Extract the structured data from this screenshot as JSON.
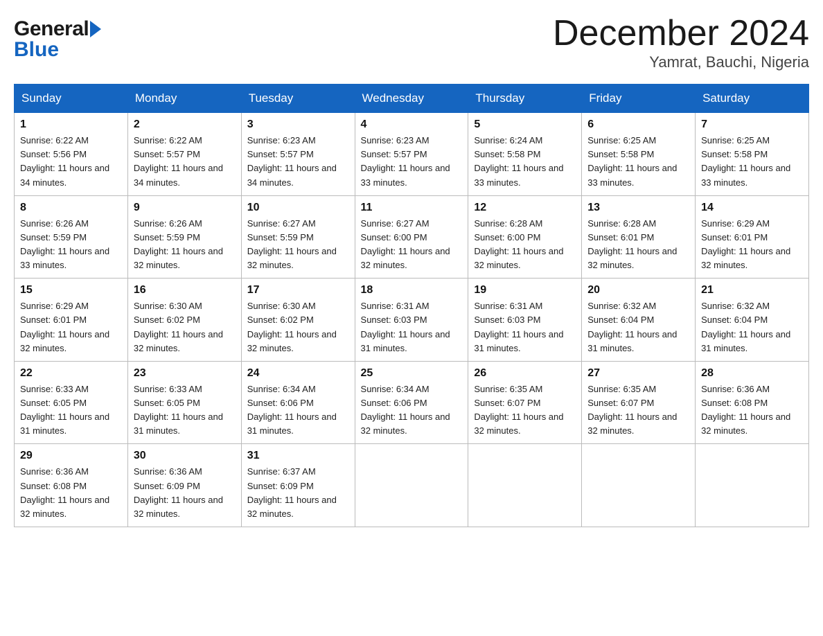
{
  "header": {
    "title": "December 2024",
    "subtitle": "Yamrat, Bauchi, Nigeria"
  },
  "logo": {
    "general": "General",
    "blue": "Blue"
  },
  "days_of_week": [
    "Sunday",
    "Monday",
    "Tuesday",
    "Wednesday",
    "Thursday",
    "Friday",
    "Saturday"
  ],
  "weeks": [
    [
      {
        "day": "1",
        "sunrise": "6:22 AM",
        "sunset": "5:56 PM",
        "daylight": "11 hours and 34 minutes."
      },
      {
        "day": "2",
        "sunrise": "6:22 AM",
        "sunset": "5:57 PM",
        "daylight": "11 hours and 34 minutes."
      },
      {
        "day": "3",
        "sunrise": "6:23 AM",
        "sunset": "5:57 PM",
        "daylight": "11 hours and 34 minutes."
      },
      {
        "day": "4",
        "sunrise": "6:23 AM",
        "sunset": "5:57 PM",
        "daylight": "11 hours and 33 minutes."
      },
      {
        "day": "5",
        "sunrise": "6:24 AM",
        "sunset": "5:58 PM",
        "daylight": "11 hours and 33 minutes."
      },
      {
        "day": "6",
        "sunrise": "6:25 AM",
        "sunset": "5:58 PM",
        "daylight": "11 hours and 33 minutes."
      },
      {
        "day": "7",
        "sunrise": "6:25 AM",
        "sunset": "5:58 PM",
        "daylight": "11 hours and 33 minutes."
      }
    ],
    [
      {
        "day": "8",
        "sunrise": "6:26 AM",
        "sunset": "5:59 PM",
        "daylight": "11 hours and 33 minutes."
      },
      {
        "day": "9",
        "sunrise": "6:26 AM",
        "sunset": "5:59 PM",
        "daylight": "11 hours and 32 minutes."
      },
      {
        "day": "10",
        "sunrise": "6:27 AM",
        "sunset": "5:59 PM",
        "daylight": "11 hours and 32 minutes."
      },
      {
        "day": "11",
        "sunrise": "6:27 AM",
        "sunset": "6:00 PM",
        "daylight": "11 hours and 32 minutes."
      },
      {
        "day": "12",
        "sunrise": "6:28 AM",
        "sunset": "6:00 PM",
        "daylight": "11 hours and 32 minutes."
      },
      {
        "day": "13",
        "sunrise": "6:28 AM",
        "sunset": "6:01 PM",
        "daylight": "11 hours and 32 minutes."
      },
      {
        "day": "14",
        "sunrise": "6:29 AM",
        "sunset": "6:01 PM",
        "daylight": "11 hours and 32 minutes."
      }
    ],
    [
      {
        "day": "15",
        "sunrise": "6:29 AM",
        "sunset": "6:01 PM",
        "daylight": "11 hours and 32 minutes."
      },
      {
        "day": "16",
        "sunrise": "6:30 AM",
        "sunset": "6:02 PM",
        "daylight": "11 hours and 32 minutes."
      },
      {
        "day": "17",
        "sunrise": "6:30 AM",
        "sunset": "6:02 PM",
        "daylight": "11 hours and 32 minutes."
      },
      {
        "day": "18",
        "sunrise": "6:31 AM",
        "sunset": "6:03 PM",
        "daylight": "11 hours and 31 minutes."
      },
      {
        "day": "19",
        "sunrise": "6:31 AM",
        "sunset": "6:03 PM",
        "daylight": "11 hours and 31 minutes."
      },
      {
        "day": "20",
        "sunrise": "6:32 AM",
        "sunset": "6:04 PM",
        "daylight": "11 hours and 31 minutes."
      },
      {
        "day": "21",
        "sunrise": "6:32 AM",
        "sunset": "6:04 PM",
        "daylight": "11 hours and 31 minutes."
      }
    ],
    [
      {
        "day": "22",
        "sunrise": "6:33 AM",
        "sunset": "6:05 PM",
        "daylight": "11 hours and 31 minutes."
      },
      {
        "day": "23",
        "sunrise": "6:33 AM",
        "sunset": "6:05 PM",
        "daylight": "11 hours and 31 minutes."
      },
      {
        "day": "24",
        "sunrise": "6:34 AM",
        "sunset": "6:06 PM",
        "daylight": "11 hours and 31 minutes."
      },
      {
        "day": "25",
        "sunrise": "6:34 AM",
        "sunset": "6:06 PM",
        "daylight": "11 hours and 32 minutes."
      },
      {
        "day": "26",
        "sunrise": "6:35 AM",
        "sunset": "6:07 PM",
        "daylight": "11 hours and 32 minutes."
      },
      {
        "day": "27",
        "sunrise": "6:35 AM",
        "sunset": "6:07 PM",
        "daylight": "11 hours and 32 minutes."
      },
      {
        "day": "28",
        "sunrise": "6:36 AM",
        "sunset": "6:08 PM",
        "daylight": "11 hours and 32 minutes."
      }
    ],
    [
      {
        "day": "29",
        "sunrise": "6:36 AM",
        "sunset": "6:08 PM",
        "daylight": "11 hours and 32 minutes."
      },
      {
        "day": "30",
        "sunrise": "6:36 AM",
        "sunset": "6:09 PM",
        "daylight": "11 hours and 32 minutes."
      },
      {
        "day": "31",
        "sunrise": "6:37 AM",
        "sunset": "6:09 PM",
        "daylight": "11 hours and 32 minutes."
      },
      null,
      null,
      null,
      null
    ]
  ]
}
